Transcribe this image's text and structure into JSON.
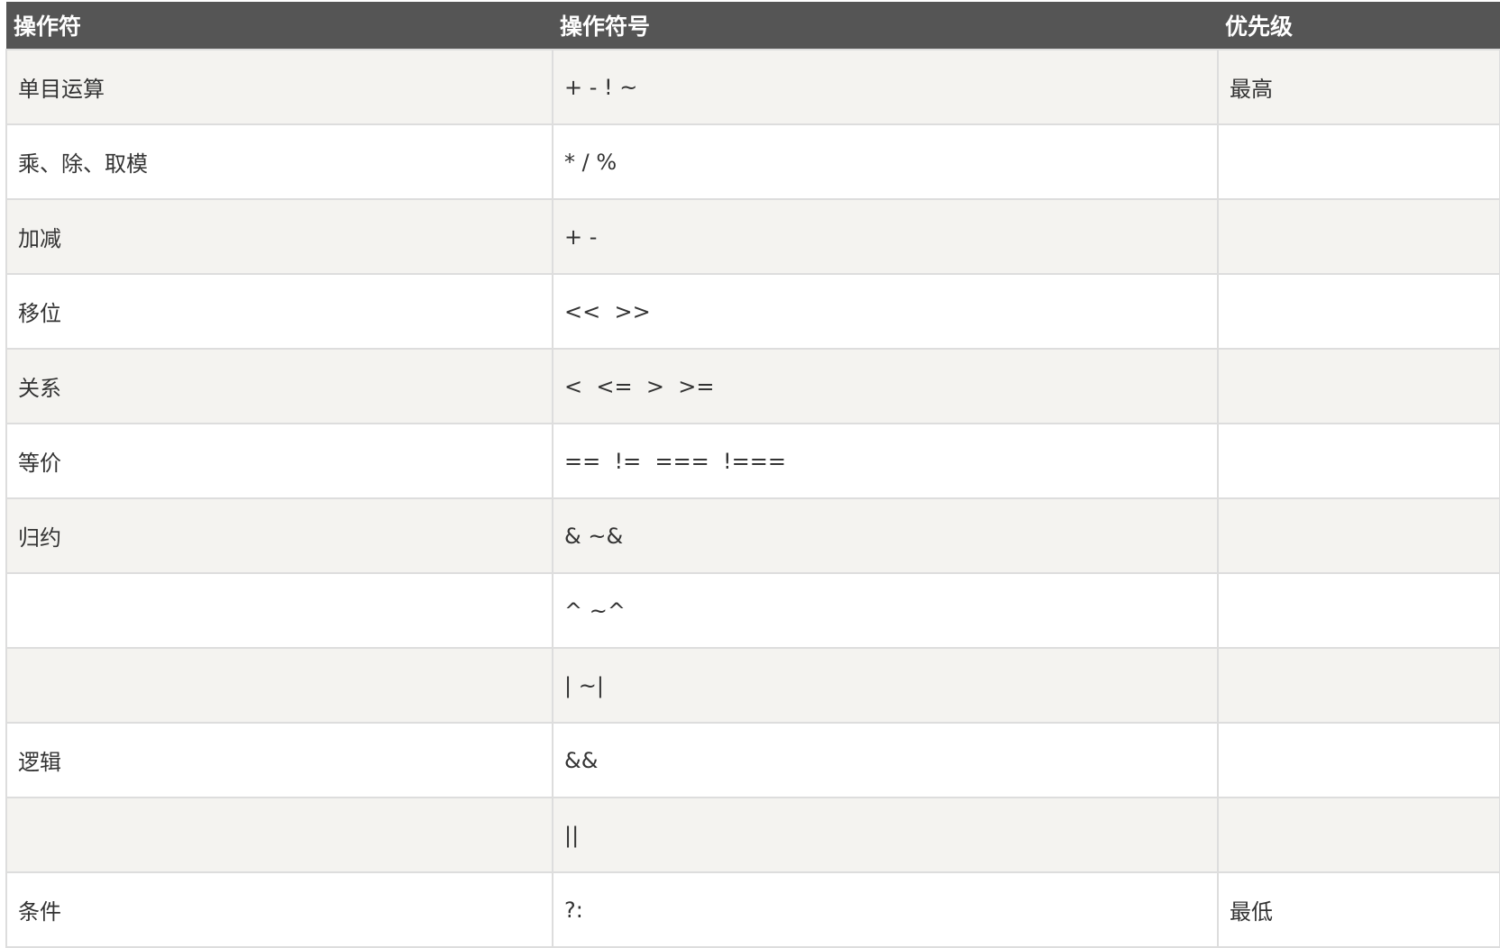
{
  "table": {
    "headers": [
      "操作符",
      "操作符号",
      "优先级"
    ],
    "rows": [
      {
        "operator": "单目运算",
        "symbols": "+ - ! ~",
        "priority": "最高"
      },
      {
        "operator": "乘、除、取模",
        "symbols": "* / %",
        "priority": ""
      },
      {
        "operator": "加减",
        "symbols": "+ -",
        "priority": ""
      },
      {
        "operator": "移位",
        "symbols": "<<  >>",
        "priority": ""
      },
      {
        "operator": "关系",
        "symbols": "<  <=  >  >=",
        "priority": ""
      },
      {
        "operator": "等价",
        "symbols": "==  !=  ===  !===",
        "priority": ""
      },
      {
        "operator": "归约",
        "symbols": "& ~&",
        "priority": ""
      },
      {
        "operator": "",
        "symbols": "^ ~^",
        "priority": ""
      },
      {
        "operator": "",
        "symbols": "| ~|",
        "priority": ""
      },
      {
        "operator": "逻辑",
        "symbols": "&&",
        "priority": ""
      },
      {
        "operator": "",
        "symbols": "||",
        "priority": ""
      },
      {
        "operator": "条件",
        "symbols": "?:",
        "priority": "最低"
      }
    ]
  }
}
